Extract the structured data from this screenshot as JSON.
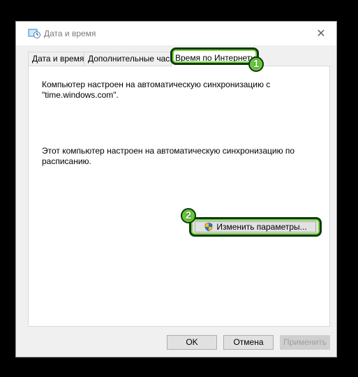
{
  "window": {
    "title": "Дата и время",
    "close_glyph": "✕"
  },
  "tabs": [
    {
      "label": "Дата и время",
      "active": false
    },
    {
      "label": "Дополнительные часы",
      "active": false
    },
    {
      "label": "Время по Интернету",
      "active": true
    }
  ],
  "content": {
    "sync_text": "Компьютер настроен на автоматическую синхронизацию с \"time.windows.com\".",
    "schedule_text": "Этот компьютер настроен на автоматическую синхронизацию по расписанию.",
    "change_button": "Изменить параметры..."
  },
  "annotations": {
    "badge_1": "1",
    "badge_2": "2",
    "highlight_color": "#7bd63b"
  },
  "footer": {
    "ok": "OK",
    "cancel": "Отмена",
    "apply": "Применить",
    "apply_enabled": false
  },
  "icons": {
    "app": "clock-globe-icon",
    "shield": "uac-shield-icon",
    "close": "close-icon"
  }
}
